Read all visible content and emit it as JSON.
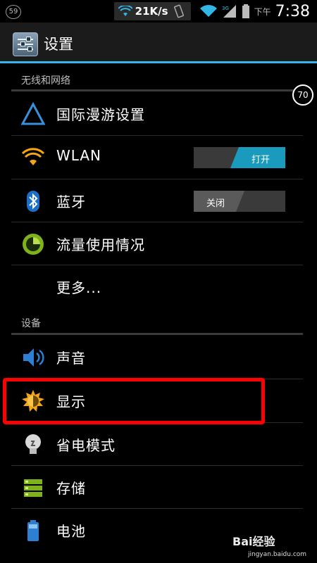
{
  "status_bar": {
    "notification_count": "59",
    "net_speed": "21K/s",
    "ampm": "下午",
    "time": "7:38"
  },
  "action_bar": {
    "title": "设置"
  },
  "sections": {
    "wireless": "无线和网络",
    "device": "设备"
  },
  "items": {
    "roaming": "国际漫游设置",
    "wlan": "WLAN",
    "bluetooth": "蓝牙",
    "data_usage": "流量使用情况",
    "more": "更多...",
    "sound": "声音",
    "display": "显示",
    "power_saving": "省电模式",
    "storage": "存储",
    "battery": "电池"
  },
  "toggles": {
    "wlan_state": "打开",
    "bluetooth_state": "关闭"
  },
  "overlay_badge": "70",
  "watermark": {
    "brand": "Bai经验",
    "url": "jingyan.baidu.com"
  },
  "colors": {
    "accent": "#33b5e5",
    "toggle_on": "#1a9bbd",
    "highlight": "#ff0000"
  }
}
